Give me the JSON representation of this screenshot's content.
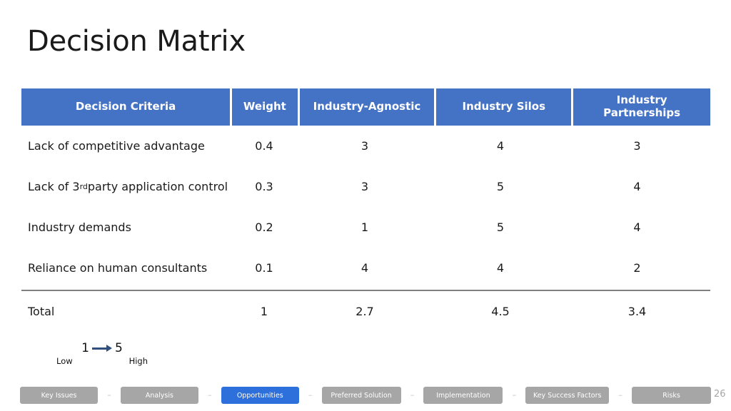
{
  "slide": {
    "title": "Decision Matrix",
    "page_number": "26"
  },
  "table": {
    "headers": {
      "criteria": "Decision Criteria",
      "weight": "Weight",
      "option_a": "Industry-Agnostic",
      "option_b": "Industry Silos",
      "option_c": "Industry Partnerships"
    },
    "rows": [
      {
        "criteria": "Lack of competitive advantage",
        "criteria_sup": "",
        "criteria_tail": "",
        "weight": "0.4",
        "option_a": "3",
        "option_b": "4",
        "option_c": "3"
      },
      {
        "criteria": "Lack of 3",
        "criteria_sup": "rd",
        "criteria_tail": " party application control",
        "weight": "0.3",
        "option_a": "3",
        "option_b": "5",
        "option_c": "4"
      },
      {
        "criteria": "Industry demands",
        "criteria_sup": "",
        "criteria_tail": "",
        "weight": "0.2",
        "option_a": "1",
        "option_b": "5",
        "option_c": "4"
      },
      {
        "criteria": "Reliance on human consultants",
        "criteria_sup": "",
        "criteria_tail": "",
        "weight": "0.1",
        "option_a": "4",
        "option_b": "4",
        "option_c": "2"
      }
    ],
    "total": {
      "criteria": "Total",
      "weight": "1",
      "option_a": "2.7",
      "option_b": "4.5",
      "option_c": "3.4"
    }
  },
  "legend": {
    "low_value": "1",
    "high_value": "5",
    "low_label": "Low",
    "high_label": "High"
  },
  "nav": {
    "separator": "–",
    "items": [
      {
        "label": "Key Issues",
        "active": false
      },
      {
        "label": "Analysis",
        "active": false
      },
      {
        "label": "Opportunities",
        "active": true
      },
      {
        "label": "Preferred Solution",
        "active": false
      },
      {
        "label": "Implementation",
        "active": false
      },
      {
        "label": "Key Success Factors",
        "active": false
      },
      {
        "label": "Risks",
        "active": false
      }
    ]
  },
  "colors": {
    "header_blue": "#4472C4",
    "nav_active_blue": "#2D6FDB",
    "nav_inactive_gray": "#A6A6A6",
    "divider_gray": "#808080",
    "arrow_navy": "#2F4F7F"
  }
}
